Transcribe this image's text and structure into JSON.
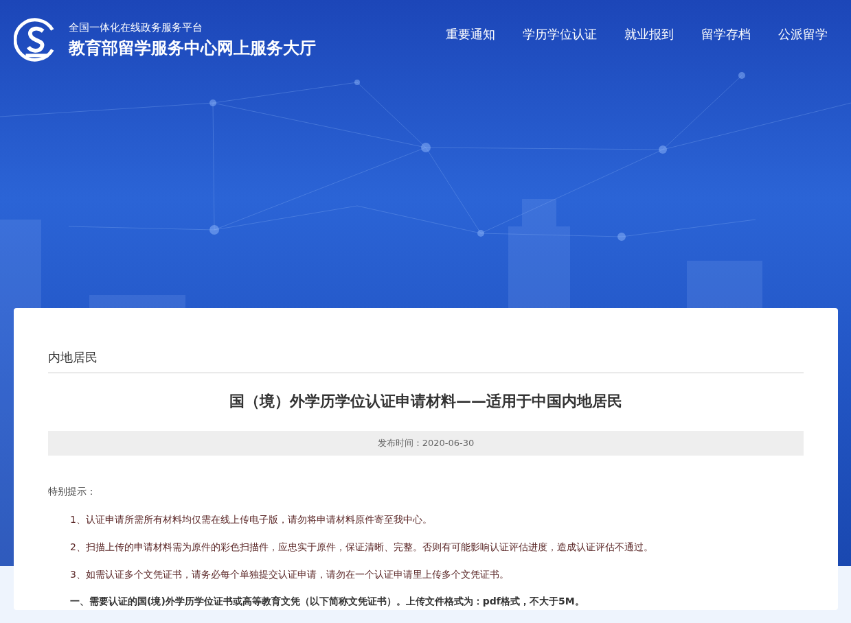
{
  "header": {
    "subtitle": "全国一体化在线政务服务平台",
    "title": "教育部留学服务中心网上服务大厅"
  },
  "nav": [
    {
      "label": "重要通知"
    },
    {
      "label": "学历学位认证"
    },
    {
      "label": "就业报到"
    },
    {
      "label": "留学存档"
    },
    {
      "label": "公派留学"
    }
  ],
  "article": {
    "category": "内地居民",
    "title": "国（境）外学历学位认证申请材料——适用于中国内地居民",
    "publish_date": "发布时间：2020-06-30",
    "notice_label": "特别提示：",
    "notices": [
      "1、认证申请所需所有材料均仅需在线上传电子版，请勿将申请材料原件寄至我中心。",
      "2、扫描上传的申请材料需为原件的彩色扫描件，应忠实于原件，保证清晰、完整。否则有可能影响认证评估进度，造成认证评估不通过。",
      "3、如需认证多个文凭证书，请务必每个单独提交认证申请，请勿在一个认证申请里上传多个文凭证书。"
    ],
    "section_heading": "一、需要认证的国(境)外学历学位证书或高等教育文凭（以下简称文凭证书）。上传文件格式为：pdf格式，不大于5M。"
  }
}
